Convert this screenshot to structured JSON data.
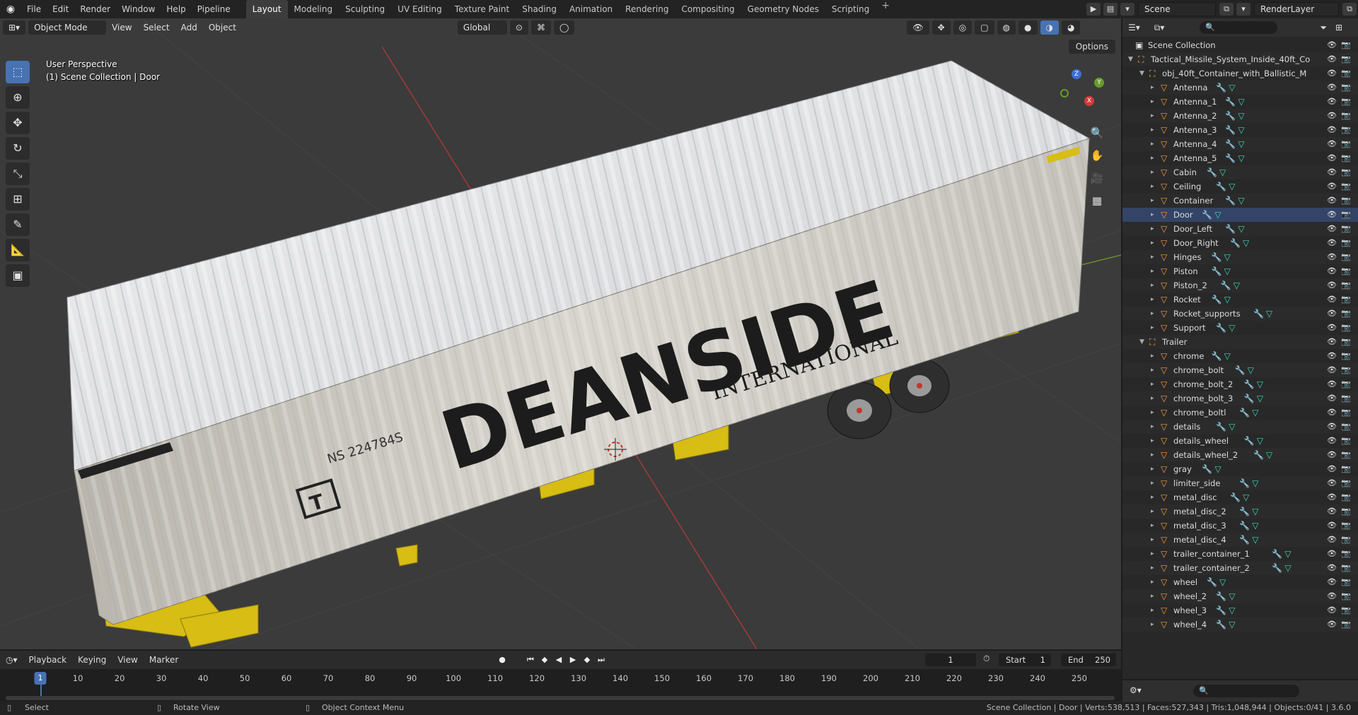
{
  "app": {
    "menus": [
      "File",
      "Edit",
      "Render",
      "Window",
      "Help",
      "Pipeline"
    ],
    "workspaces": [
      "Layout",
      "Modeling",
      "Sculpting",
      "UV Editing",
      "Texture Paint",
      "Shading",
      "Animation",
      "Rendering",
      "Compositing",
      "Geometry Nodes",
      "Scripting"
    ],
    "active_workspace": "Layout",
    "scene": "Scene",
    "render_layer": "RenderLayer"
  },
  "viewport": {
    "mode": "Object Mode",
    "menus": [
      "View",
      "Select",
      "Add",
      "Object"
    ],
    "orientation": "Global",
    "options_label": "Options",
    "perspective_label": "User Perspective",
    "context_label": "(1) Scene Collection | Door",
    "container_brand": "DEANSIDE",
    "container_sub": "INTERNATIONAL",
    "container_code": "NS 224784S",
    "container_logo": "T",
    "gizmo": {
      "x": "X",
      "y": "Y",
      "z": "Z"
    }
  },
  "outliner": {
    "root": "Scene Collection",
    "collection": "Tactical_Missile_System_Inside_40ft_Co",
    "group1": "obj_40ft_Container_with_Ballistic_M",
    "group1_items": [
      "Antenna",
      "Antenna_1",
      "Antenna_2",
      "Antenna_3",
      "Antenna_4",
      "Antenna_5",
      "Cabin",
      "Ceiling",
      "Container",
      "Door",
      "Door_Left",
      "Door_Right",
      "Hinges",
      "Piston",
      "Piston_2",
      "Rocket",
      "Rocket_supports",
      "Support"
    ],
    "group2": "Trailer",
    "group2_items": [
      "chrome",
      "chrome_bolt",
      "chrome_bolt_2",
      "chrome_bolt_3",
      "chrome_boltl",
      "details",
      "details_wheel",
      "details_wheel_2",
      "gray",
      "limiter_side",
      "metal_disc",
      "metal_disc_2",
      "metal_disc_3",
      "metal_disc_4",
      "trailer_container_1",
      "trailer_container_2",
      "wheel",
      "wheel_2",
      "wheel_3",
      "wheel_4"
    ],
    "selected": "Door"
  },
  "timeline": {
    "menus": [
      "Playback",
      "Keying",
      "View",
      "Marker"
    ],
    "current_frame": "1",
    "start_label": "Start",
    "start": "1",
    "end_label": "End",
    "end": "250",
    "ticks": [
      "1",
      "10",
      "20",
      "30",
      "40",
      "50",
      "60",
      "70",
      "80",
      "90",
      "100",
      "110",
      "120",
      "130",
      "140",
      "150",
      "160",
      "170",
      "180",
      "190",
      "200",
      "210",
      "220",
      "230",
      "240",
      "250"
    ]
  },
  "statusbar": {
    "select": "Select",
    "rotate": "Rotate View",
    "context_menu": "Object Context Menu",
    "stats": "Scene Collection | Door | Verts:538,513 | Faces:527,343 | Tris:1,048,944 | Objects:0/41 | 3.6.0"
  },
  "colors": {
    "accent": "#4772b3",
    "object_icon": "#f49c43",
    "container": "#d9d6cf",
    "yellow": "#d7bd14"
  }
}
